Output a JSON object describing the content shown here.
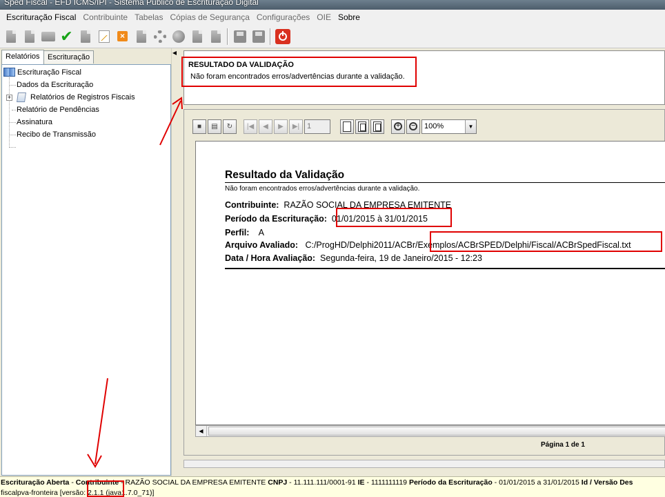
{
  "window": {
    "title": "Sped Fiscal - EFD ICMS/IPI - Sistema Público de Escrituração Digital"
  },
  "menu": [
    {
      "label": "Escrituração Fiscal",
      "enabled": true
    },
    {
      "label": "Contribuinte",
      "enabled": false
    },
    {
      "label": "Tabelas",
      "enabled": false
    },
    {
      "label": "Cópias de Segurança",
      "enabled": false
    },
    {
      "label": "Configurações",
      "enabled": false
    },
    {
      "label": "OIE",
      "enabled": false
    },
    {
      "label": "Sobre",
      "enabled": true
    }
  ],
  "toolbar": {
    "icons": [
      "new-document-icon",
      "open-icon",
      "folder-icon",
      "validate-check-icon",
      "sign-icon",
      "chart-icon",
      "delete-icon",
      "import-icon",
      "export-icon",
      "globe-icon",
      "transmit-icon",
      "receipt-icon",
      "save-icon",
      "save-as-icon",
      "exit-icon"
    ]
  },
  "left_panel": {
    "tabs": [
      {
        "label": "Relatórios",
        "active": true
      },
      {
        "label": "Escrituração",
        "active": false
      }
    ],
    "tree": [
      {
        "label": "Escrituração Fiscal",
        "level": 0
      },
      {
        "label": "Dados da Escrituração",
        "level": 1
      },
      {
        "label": "Relatórios de Registros Fiscais",
        "level": 1
      },
      {
        "label": "Relatório de Pendências",
        "level": 1
      },
      {
        "label": "Assinatura",
        "level": 1
      },
      {
        "label": "Recibo de Transmissão",
        "level": 1
      }
    ]
  },
  "validation_box": {
    "title": "RESULTADO DA VALIDAÇÃO",
    "message": "Não foram encontrados erros/advertências durante a validação."
  },
  "viewer": {
    "page_field": "1",
    "zoom": "100%",
    "page_label": "Página 1 de 1"
  },
  "report": {
    "title": "Resultado da Validação",
    "subtitle": "Não foram encontrados erros/advertências durante a validação.",
    "contribuinte_label": "Contribuinte:",
    "contribuinte_value": "RAZÃO SOCIAL DA EMPRESA EMITENTE",
    "periodo_label": "Período da Escrituração:",
    "periodo_value": "01/01/2015 à 31/01/2015",
    "perfil_label": "Perfil:",
    "perfil_value": "A",
    "arquivo_label": "Arquivo Avaliado:",
    "arquivo_value": "C:/ProgHD/Delphi2011/ACBr/Exemplos/ACBrSPED/Delphi/Fiscal/ACBrSpedFiscal.txt",
    "data_label": "Data / Hora Avaliação:",
    "data_value": "Segunda-feira, 19 de Janeiro/2015 - 12:23"
  },
  "status": {
    "s1": "Escrituração Aberta",
    "s2": " - ",
    "s3": "Contribuinte",
    "s4": " - RAZÃO SOCIAL DA EMPRESA EMITENTE ",
    "s5": "CNPJ",
    "s6": " - 11.111.111/0001-91 ",
    "s7": "IE",
    "s8": " - 1111111119 ",
    "s9": "Período da Escrituração",
    "s10": " - 01/01/2015 a 31/01/2015 ",
    "s11": "Id / Versão Des",
    "line2": "fiscalpva-fronteira [versão: 2.1.1 (java1.7.0_71)]"
  },
  "colors": {
    "annotation_red": "#e00000",
    "status_bg": "#ffffe1",
    "panel_bg": "#ece9d8"
  }
}
